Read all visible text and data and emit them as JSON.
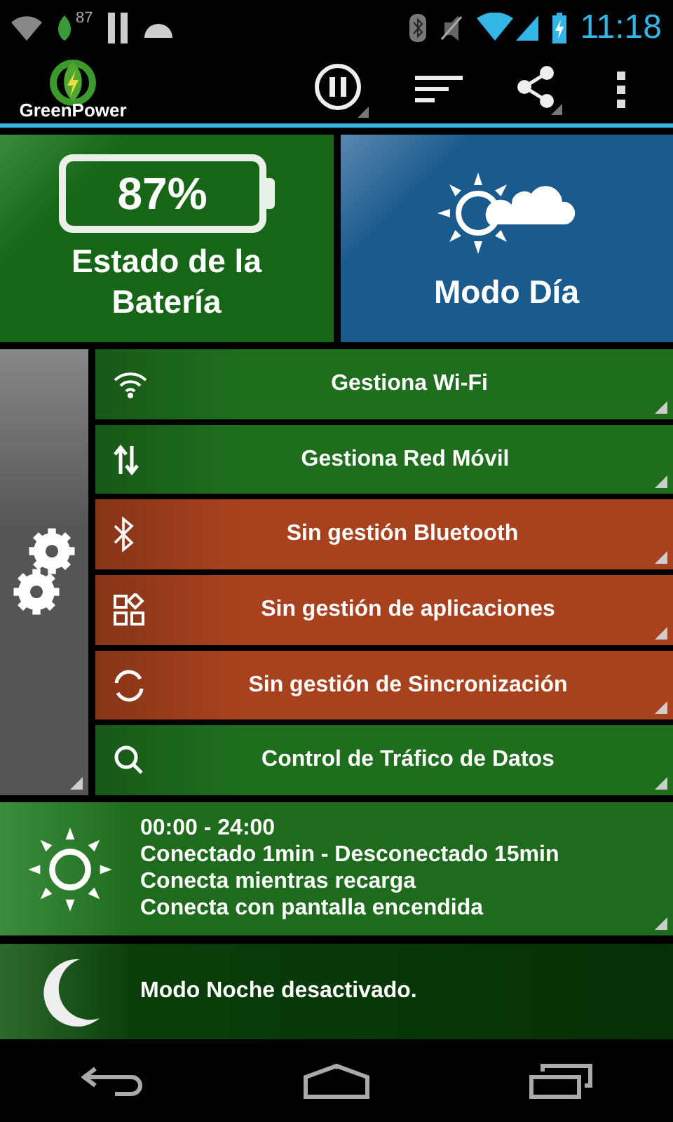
{
  "status_bar": {
    "notification_count": "87",
    "time": "11:18"
  },
  "app_bar": {
    "logo_text": "GreenPower"
  },
  "battery_tile": {
    "percent": "87%",
    "label": "Estado de la Batería"
  },
  "mode_tile": {
    "label": "Modo Día"
  },
  "controls": [
    {
      "label": "Gestiona Wi-Fi",
      "managed": true
    },
    {
      "label": "Gestiona Red Móvil",
      "managed": true
    },
    {
      "label": "Sin gestión Bluetooth",
      "managed": false
    },
    {
      "label": "Sin gestión de aplicaciones",
      "managed": false
    },
    {
      "label": "Sin gestión de Sincronización",
      "managed": false
    },
    {
      "label": "Control de Tráfico de Datos",
      "managed": true
    }
  ],
  "day_schedule": {
    "lines": [
      "00:00 - 24:00",
      "Conectado 1min - Desconectado 15min",
      "Conecta mientras recarga",
      "Conecta con pantalla encendida"
    ]
  },
  "night_mode": {
    "text": "Modo Noche desactivado."
  }
}
